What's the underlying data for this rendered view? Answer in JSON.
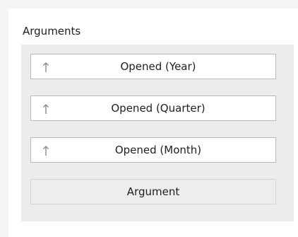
{
  "section": {
    "title": "Arguments"
  },
  "arguments": [
    {
      "label": "Opened (Year)",
      "sort_icon": "sort-ascending-icon"
    },
    {
      "label": "Opened (Quarter)",
      "sort_icon": "sort-ascending-icon"
    },
    {
      "label": "Opened (Month)",
      "sort_icon": "sort-ascending-icon"
    }
  ],
  "placeholder": {
    "label": "Argument"
  },
  "colors": {
    "panel": "#ffffff",
    "drop_area": "#ececec",
    "item_border": "#b9b9b9",
    "icon": "#8a8a8a",
    "text": "#1e1e1e"
  }
}
